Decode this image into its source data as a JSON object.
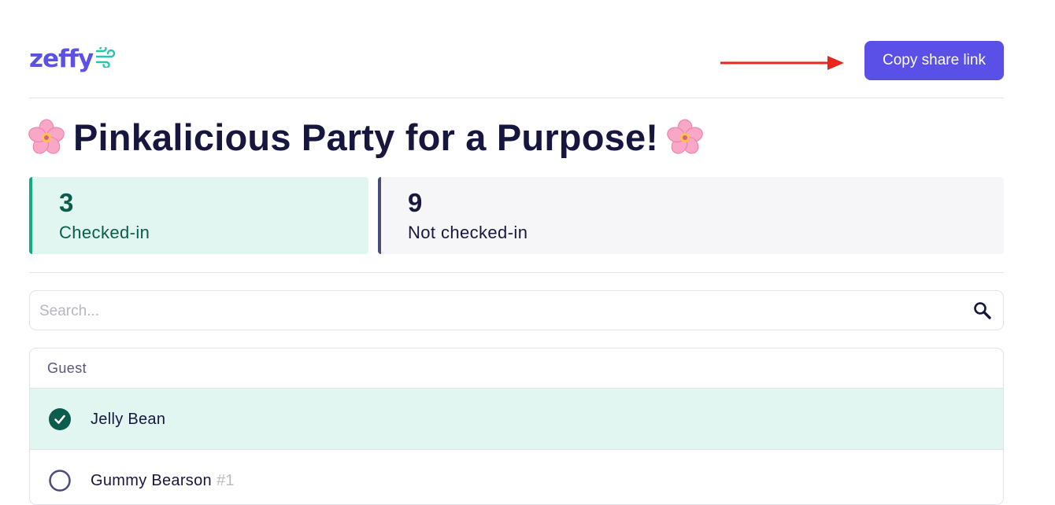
{
  "header": {
    "logo_text": "zeffy",
    "share_button_label": "Copy share link"
  },
  "event": {
    "title": "Pinkalicious Party for a Purpose!"
  },
  "stats": {
    "checked_in": {
      "count": "3",
      "label": "Checked-in"
    },
    "not_checked_in": {
      "count": "9",
      "label": "Not checked-in"
    }
  },
  "search": {
    "placeholder": "Search...",
    "value": ""
  },
  "table": {
    "header": "Guest",
    "rows": [
      {
        "name": "Jelly Bean",
        "number": "",
        "checked": true
      },
      {
        "name": "Gummy Bearson",
        "number": "#1",
        "checked": false
      }
    ]
  },
  "colors": {
    "brand": "#5a4fe6",
    "checked_accent": "#17a886",
    "checked_bg": "#e1f6f1",
    "annotation_arrow": "#e8281c"
  }
}
